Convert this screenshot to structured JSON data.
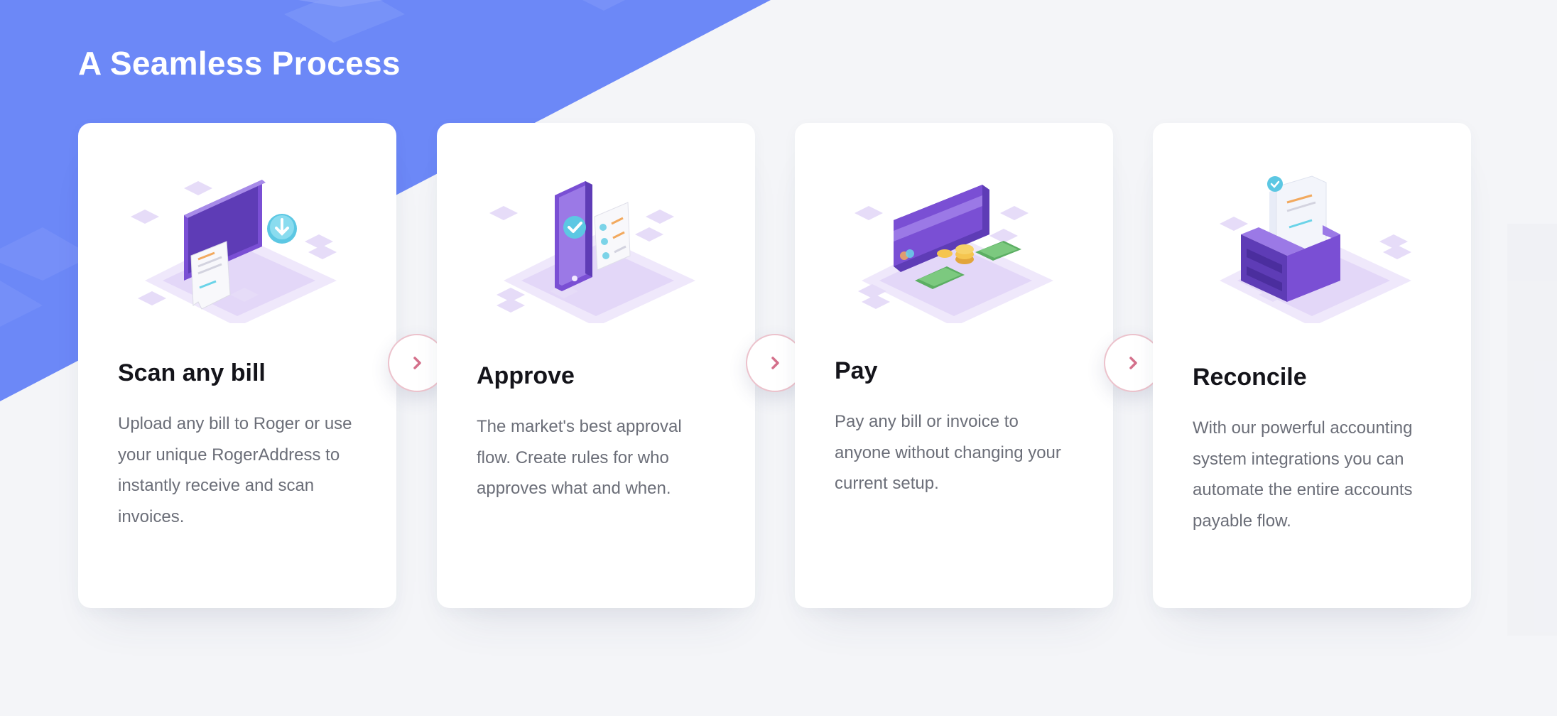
{
  "section": {
    "title": "A Seamless Process"
  },
  "steps": [
    {
      "title": "Scan any bill",
      "description": "Upload any bill to Roger or use your unique RogerAddress to instantly receive and scan invoices.",
      "icon": "scan-bill-illustration"
    },
    {
      "title": "Approve",
      "description": "The market's best approval flow. Create rules for who approves what and when.",
      "icon": "approve-phone-illustration"
    },
    {
      "title": "Pay",
      "description": "Pay any bill or invoice to anyone without changing your current setup.",
      "icon": "pay-card-illustration"
    },
    {
      "title": "Reconcile",
      "description": "With our powerful accounting system integrations you can automate the entire accounts payable flow.",
      "icon": "reconcile-box-illustration"
    }
  ],
  "colors": {
    "background": "#f4f5f8",
    "hero": "#6c88f7",
    "card": "#ffffff",
    "title_text": "#14141a",
    "body_text": "#6b6e78",
    "arrow": "#d4708b",
    "illustration_purple": "#7a4fd4"
  }
}
